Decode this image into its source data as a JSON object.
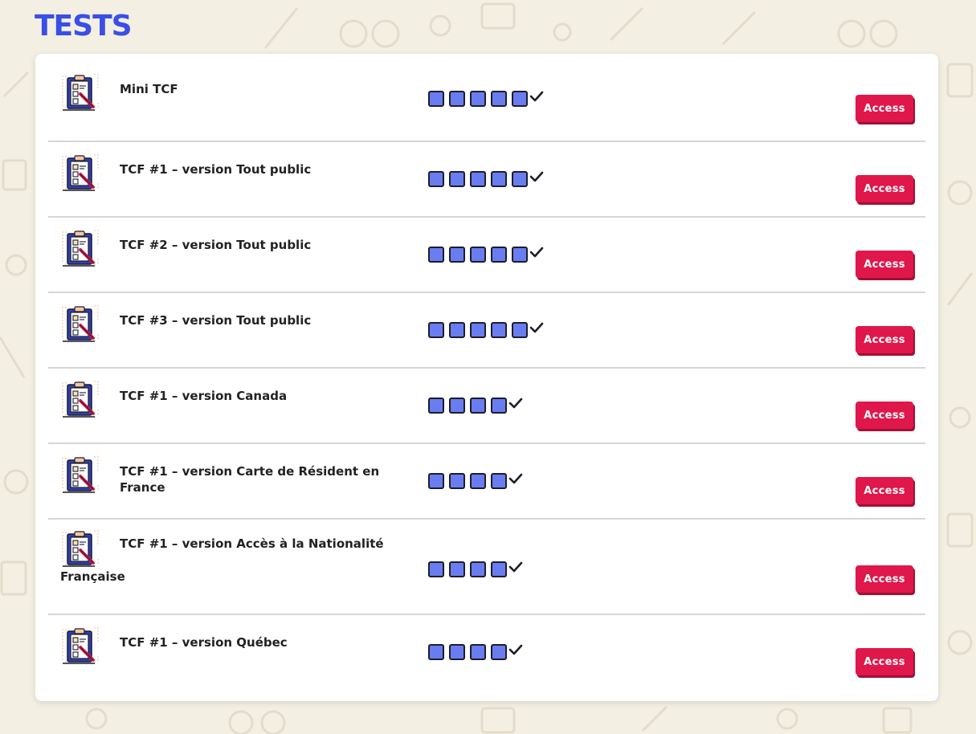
{
  "header": {
    "title": "TESTS"
  },
  "colors": {
    "accent": "#3a4fe6",
    "button": "#e0174a",
    "level_square": "#6a7df0",
    "background": "#f3efe3"
  },
  "tests": [
    {
      "title": "Mini TCF",
      "level": 5,
      "action_label": "Access",
      "icon": "clipboard-checklist-icon"
    },
    {
      "title": "TCF #1 – version Tout public",
      "level": 5,
      "action_label": "Access",
      "icon": "clipboard-checklist-icon"
    },
    {
      "title": "TCF #2 – version Tout public",
      "level": 5,
      "action_label": "Access",
      "icon": "clipboard-checklist-icon"
    },
    {
      "title": "TCF #3 – version Tout public",
      "level": 5,
      "action_label": "Access",
      "icon": "clipboard-checklist-icon"
    },
    {
      "title": "TCF #1 – version Canada",
      "level": 4,
      "action_label": "Access",
      "icon": "clipboard-checklist-icon"
    },
    {
      "title": "TCF #1 – version Carte de Résident en France",
      "level": 4,
      "action_label": "Access",
      "icon": "clipboard-checklist-icon"
    },
    {
      "title": "TCF #1 – version Accès à la Nationalité Française",
      "level": 4,
      "action_label": "Access",
      "icon": "clipboard-checklist-icon"
    },
    {
      "title": "TCF #1 – version Québec",
      "level": 4,
      "action_label": "Access",
      "icon": "clipboard-checklist-icon"
    }
  ]
}
